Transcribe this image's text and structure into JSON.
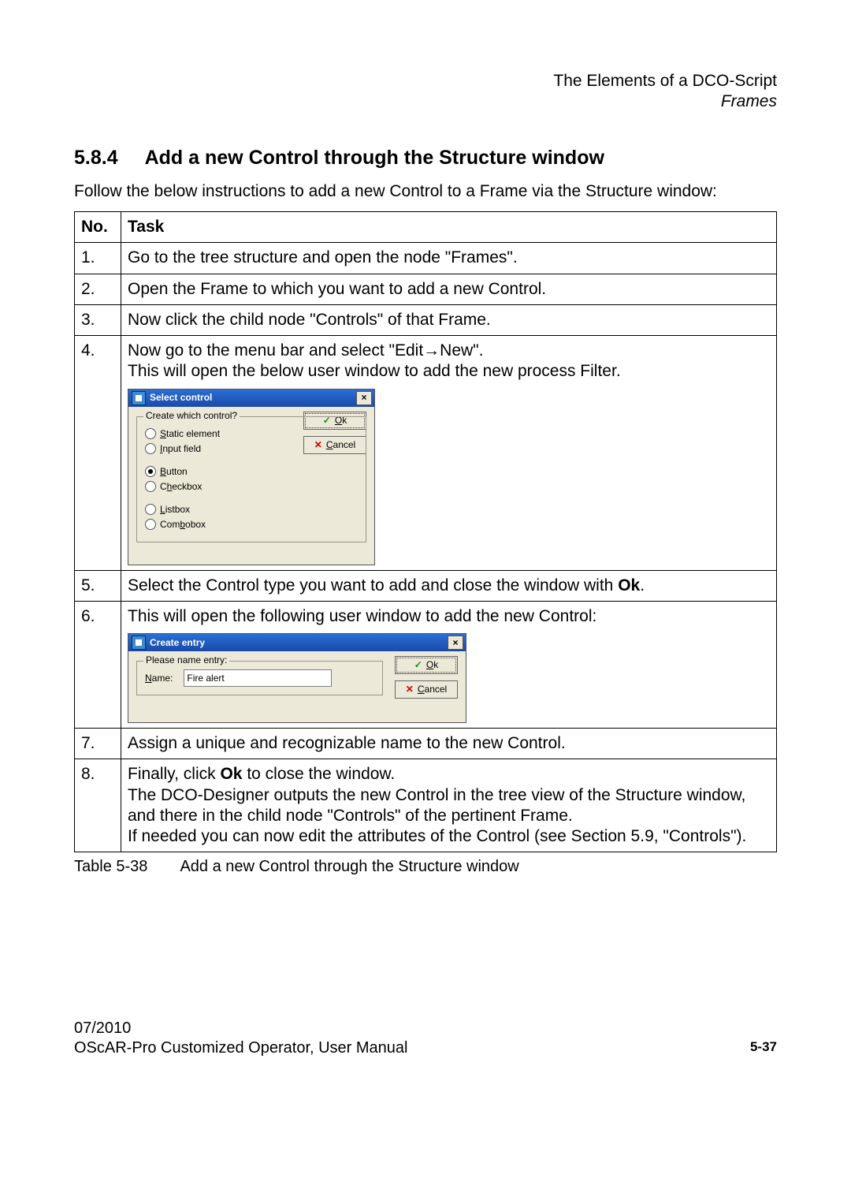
{
  "header": {
    "l1": "The Elements of a DCO-Script",
    "l2": "Frames"
  },
  "section": {
    "num": "5.8.4",
    "title": "Add a new Control through the Structure window"
  },
  "intro": "Follow the below instructions to add a new Control to a Frame via the Structure window:",
  "table": {
    "h1": "No.",
    "h2": "Task",
    "r1": {
      "n": "1.",
      "t": "Go to the tree structure and open the node \"Frames\"."
    },
    "r2": {
      "n": "2.",
      "t": "Open the Frame to which you want to add a new Control."
    },
    "r3": {
      "n": "3.",
      "t": "Now click the child node \"Controls\" of that Frame."
    },
    "r4": {
      "n": "4.",
      "t1": "Now go to the menu bar and select \"Edit→New\".",
      "t2": "This will open the below user window to add the new process Filter."
    },
    "r5": {
      "n": "5.",
      "ta": "Select the Control type you want to add and close the window with ",
      "tb": "Ok",
      "tc": "."
    },
    "r6": {
      "n": "6.",
      "t": "This will open the following user window to add the new Control:"
    },
    "r7": {
      "n": "7.",
      "t": "Assign a unique and recognizable name to the new Control."
    },
    "r8": {
      "n": "8.",
      "t1": "Finally, click ",
      "t1b": "Ok",
      "t1c": " to close the window.",
      "t2": "The DCO-Designer outputs the new Control in the tree view of the Structure window, and there in the child node \"Controls\" of the pertinent Frame.",
      "t3": "If needed you can now edit the attributes of the Control (see Section 5.9, \"Controls\")."
    }
  },
  "caption": {
    "lbl": "Table 5-38",
    "txt": "Add a new Control through the Structure window"
  },
  "dlg1": {
    "title": "Select control",
    "legend": "Create which control?",
    "opts": {
      "o1": "Static element",
      "o2": "Input field",
      "o3": "Button",
      "o4": "Checkbox",
      "o5": "Listbox",
      "o6": "Combobox"
    },
    "ok": "Ok",
    "cancel": "Cancel"
  },
  "dlg2": {
    "title": "Create entry",
    "legend": "Please name entry:",
    "name_lbl": "Name:",
    "name_val": "Fire alert",
    "ok": "Ok",
    "cancel": "Cancel"
  },
  "footer": {
    "date": "07/2010",
    "manual": "OScAR-Pro Customized Operator, User Manual",
    "page": "5-37"
  }
}
